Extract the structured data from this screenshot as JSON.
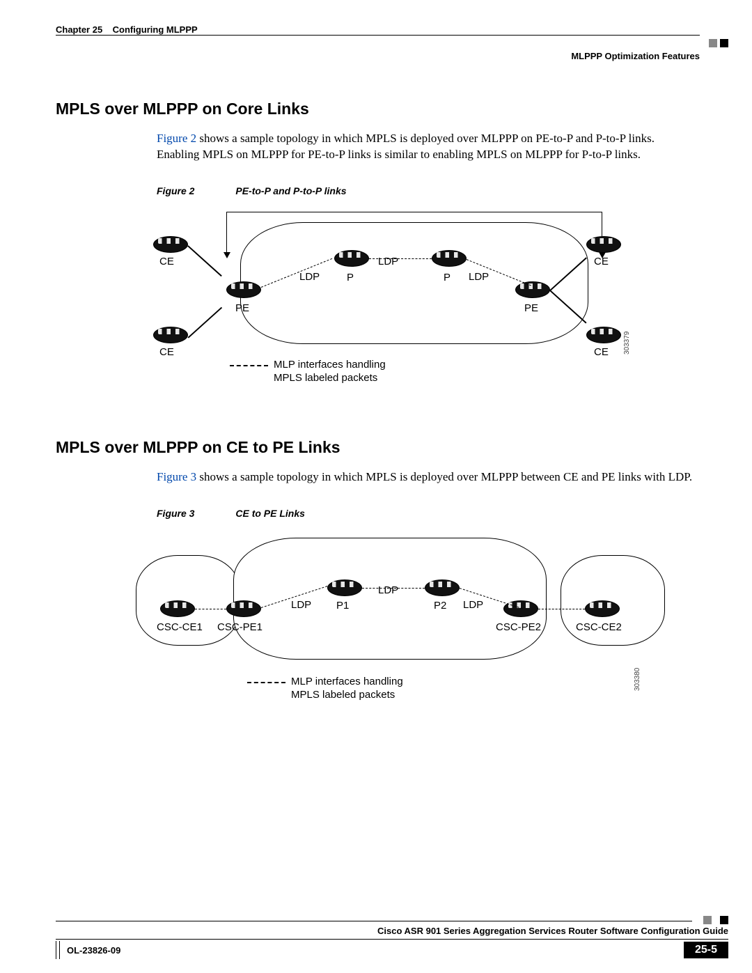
{
  "header": {
    "chapter": "Chapter 25",
    "chapter_title": "Configuring MLPPP",
    "subtitle": "MLPPP Optimization Features"
  },
  "section1": {
    "heading": "MPLS over MLPPP on Core Links",
    "figref": "Figure 2",
    "text_after_ref": " shows a sample topology in which MPLS is deployed over MLPPP on PE-to-P and P-to-P links. Enabling MPLS on MLPPP for PE-to-P links is similar to enabling MPLS on MLPPP for P-to-P links.",
    "fig_label": "Figure 2",
    "fig_title": "PE-to-P and P-to-P links",
    "diagram": {
      "labels": {
        "ce_tl": "CE",
        "ce_bl": "CE",
        "ce_tr": "CE",
        "ce_br": "CE",
        "pe_l": "PE",
        "pe_r": "PE",
        "p_l": "P",
        "p_r": "P",
        "ldp_l": "LDP",
        "ldp_m": "LDP",
        "ldp_r": "LDP"
      },
      "legend_line1": "MLP interfaces handling",
      "legend_line2": "MPLS labeled packets",
      "image_id": "303379"
    }
  },
  "section2": {
    "heading": "MPLS over MLPPP on CE to PE Links",
    "figref": "Figure 3",
    "text_after_ref": " shows a sample topology in which MPLS is deployed over MLPPP between CE and PE links with LDP.",
    "fig_label": "Figure 3",
    "fig_title": "CE to PE Links",
    "diagram": {
      "labels": {
        "csc_ce1": "CSC-CE1",
        "csc_pe1": "CSC-PE1",
        "p1": "P1",
        "p2": "P2",
        "csc_pe2": "CSC-PE2",
        "csc_ce2": "CSC-CE2",
        "ldp_l": "LDP",
        "ldp_m": "LDP",
        "ldp_r": "LDP"
      },
      "legend_line1": "MLP interfaces handling",
      "legend_line2": "MPLS labeled packets",
      "image_id": "303380"
    }
  },
  "footer": {
    "book_title": "Cisco ASR 901 Series Aggregation Services Router Software Configuration Guide",
    "doc_id": "OL-23826-09",
    "page": "25-5"
  }
}
